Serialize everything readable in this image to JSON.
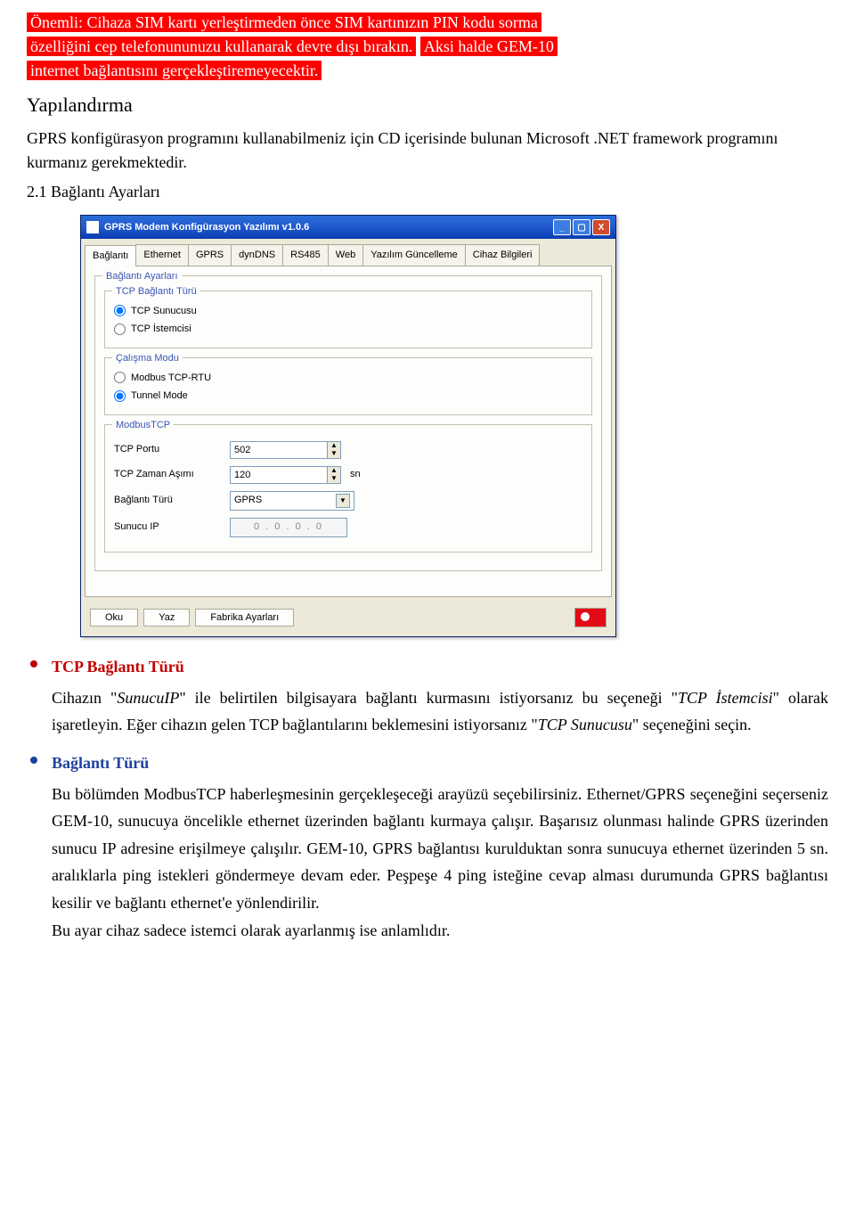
{
  "para1": {
    "l1": "Önemli: Cihaza SIM kartı yerleştirmeden önce SIM kartınızın PIN kodu sorma",
    "l2": "özelliğini cep telefonununuzu kullanarak devre dışı bırakın.",
    "l3a": "Aksi halde GEM-10",
    "l3b": "internet bağlantısını gerçekleştiremeyecektir."
  },
  "h2": "Yapılandırma",
  "para2": "GPRS konfigürasyon programını kullanabilmeniz için CD içerisinde bulunan Microsoft .NET framework programını kurmanız gerekmektedir.",
  "h3": "2.1 Bağlantı Ayarları",
  "app": {
    "title": "GPRS Modem Konfigürasyon Yazılımı v1.0.6",
    "tabs": [
      "Bağlantı",
      "Ethernet",
      "GPRS",
      "dynDNS",
      "RS485",
      "Web",
      "Yazılım Güncelleme",
      "Cihaz Bilgileri"
    ],
    "group_main": "Bağlantı Ayarları",
    "group_tcp": "TCP Bağlantı Türü",
    "tcp_server": "TCP Sunucusu",
    "tcp_client": "TCP İstemcisi",
    "group_mode": "Çalışma Modu",
    "mode_modbus": "Modbus TCP-RTU",
    "mode_tunnel": "Tunnel Mode",
    "group_modbus": "ModbusTCP",
    "lbl_port": "TCP Portu",
    "val_port": "502",
    "lbl_timeout": "TCP Zaman Aşımı",
    "val_timeout": "120",
    "unit_timeout": "sn",
    "lbl_conntype": "Bağlantı Türü",
    "val_conntype": "GPRS",
    "lbl_serverip": "Sunucu IP",
    "val_serverip": "0 . 0 . 0 . 0",
    "btn_read": "Oku",
    "btn_write": "Yaz",
    "btn_factory": "Fabrika Ayarları"
  },
  "bullets": {
    "b1": {
      "title": "TCP Bağlantı Türü",
      "body_a": "Cihazın \"",
      "body_b": "SunucuIP",
      "body_c": "\" ile belirtilen bilgisayara bağlantı kurmasını istiyorsanız bu seçeneği \"",
      "body_d": "TCP İstemcisi",
      "body_e": "\" olarak işaretleyin. Eğer cihazın gelen TCP bağlantılarını beklemesini istiyorsanız \"",
      "body_f": "TCP Sunucusu",
      "body_g": "\" seçeneğini seçin."
    },
    "b2": {
      "title": "Bağlantı Türü",
      "body": "Bu bölümden ModbusTCP haberleşmesinin gerçekleşeceği arayüzü seçebilirsiniz. Ethernet/GPRS seçeneğini seçerseniz GEM-10, sunucuya öncelikle ethernet üzerinden bağlantı kurmaya çalışır. Başarısız olunması halinde GPRS üzerinden sunucu IP adresine erişilmeye çalışılır. GEM-10, GPRS bağlantısı kurulduktan sonra sunucuya ethernet üzerinden 5 sn. aralıklarla ping istekleri göndermeye devam eder. Peşpeşe 4 ping isteğine cevap alması durumunda GPRS bağlantısı kesilir ve bağlantı ethernet'e yönlendirilir.",
      "body2": "Bu ayar cihaz sadece istemci olarak ayarlanmış ise anlamlıdır."
    }
  }
}
